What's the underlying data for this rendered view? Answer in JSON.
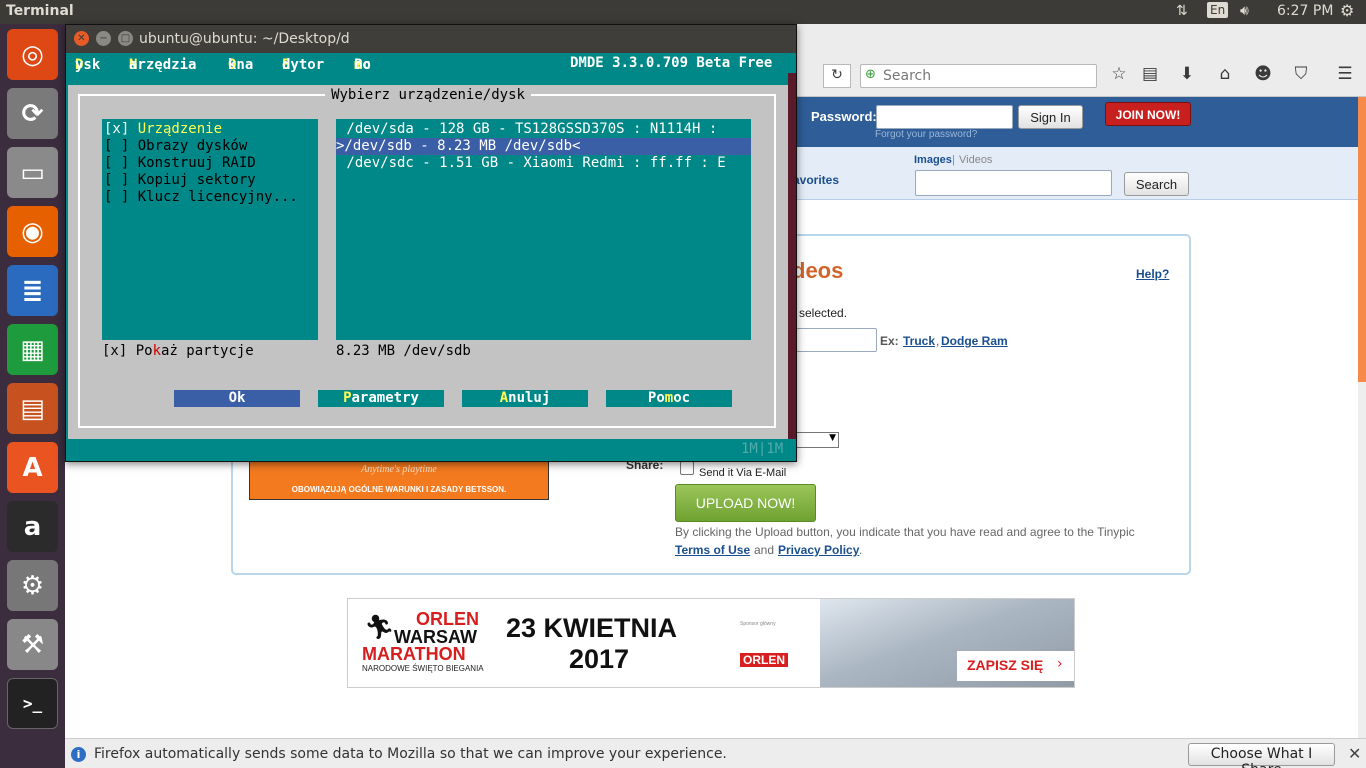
{
  "topbar": {
    "app_title": "Terminal",
    "keyboard": "En",
    "time": "6:27 PM"
  },
  "launcher": {
    "items": [
      {
        "name": "ubuntu-dash",
        "glyph": "◎",
        "color": "#dd4814"
      },
      {
        "name": "software-updater",
        "glyph": "⟳",
        "color": "#7a7a7a"
      },
      {
        "name": "file-manager",
        "glyph": "▭",
        "color": "#8a8a8a"
      },
      {
        "name": "firefox",
        "glyph": "◉",
        "color": "#e66000"
      },
      {
        "name": "libreoffice-writer",
        "glyph": "≣",
        "color": "#2a6bbf"
      },
      {
        "name": "libreoffice-calc",
        "glyph": "▦",
        "color": "#1e9b3c"
      },
      {
        "name": "libreoffice-impress",
        "glyph": "▤",
        "color": "#c7511f"
      },
      {
        "name": "ubuntu-software",
        "glyph": "A",
        "color": "#e95420"
      },
      {
        "name": "amazon",
        "glyph": "a",
        "color": "#2b2b2b"
      },
      {
        "name": "system-settings",
        "glyph": "⚙",
        "color": "#777"
      },
      {
        "name": "disks",
        "glyph": "⚒",
        "color": "#888"
      },
      {
        "name": "terminal",
        "glyph": ">_",
        "color": "#222"
      }
    ]
  },
  "firefox": {
    "search_placeholder": "Search",
    "site": {
      "password_label": "Password:",
      "forgot_link": "Forgot your password?",
      "sign_in": "Sign In",
      "join_now": "JOIN NOW!",
      "favorites": "avorites",
      "images_tab": "Images",
      "sep": "|",
      "videos_tab": "Videos",
      "search_button": "Search",
      "heading_fragment": "deos",
      "help_link": "Help?",
      "selected_text": "selected.",
      "example_label": "Ex:",
      "example_1": "Truck",
      "example_comma": ",",
      "example_2": "Dodge Ram",
      "share_label": "Share:",
      "email_option": "Send it Via E-Mail",
      "upload_button": "UPLOAD NOW!",
      "agree_text": "By clicking the Upload button, you indicate that you have read and agree to the Tinypic",
      "terms_link": "Terms of Use",
      "and_text": "and",
      "privacy_link": "Privacy Policy",
      "period": "."
    },
    "ad_betsson": {
      "tagline": "Anytime's playtime",
      "footer": "OBOWIĄZUJĄ OGÓLNE WARUNKI I ZASADY BETSSON."
    },
    "ad_orlen": {
      "brand_1": "ORLEN",
      "brand_2": "WARSAW",
      "brand_3": "MARATHON",
      "sub": "NARODOWE ŚWIĘTO BIEGANIA",
      "date_1": "23 KWIETNIA",
      "date_2": "2017",
      "sponsor_small": "Sponsor główny",
      "sponsor": "ORLEN",
      "cta": "ZAPISZ SIĘ"
    },
    "notice": {
      "text": "Firefox automatically sends some data to Mozilla so that we can improve your experience.",
      "button": "Choose What I Share"
    }
  },
  "terminal": {
    "title": "ubuntu@ubuntu: ~/Desktop/d",
    "menu": [
      {
        "pre": "",
        "hot": "D",
        "post": "ysk"
      },
      {
        "pre": "",
        "hot": "N",
        "post": "arzędzia"
      },
      {
        "pre": "",
        "hot": "O",
        "post": "kna"
      },
      {
        "pre": "",
        "hot": "E",
        "post": "dytor"
      },
      {
        "pre": "Po",
        "hot": "m",
        "post": "oc"
      }
    ],
    "version": "DMDE 3.3.0.709 Beta Free",
    "dialog_title": "Wybierz urządzenie/dysk",
    "left_options": [
      {
        "box": "[x] ",
        "label": "Urządzenie"
      },
      {
        "box": "[ ] ",
        "label": "Obrazy dysków"
      },
      {
        "box": "[ ] ",
        "label": "Konstruuj RAID"
      },
      {
        "box": "[ ] ",
        "label": "Kopiuj sektory"
      },
      {
        "box": "[ ] ",
        "label": "Klucz licencyjny..."
      }
    ],
    "devices": [
      " /dev/sda - 128 GB - TS128GSSD370S : N1114H :",
      ">/dev/sdb - 8.23 MB /dev/sdb<",
      " /dev/sdc - 1.51 GB - Xiaomi Redmi : ff.ff : E"
    ],
    "show_partitions": {
      "pre": "[x] Po",
      "hot": "k",
      "post": "aż partycje"
    },
    "selected_info": "8.23 MB /dev/sdb",
    "buttons": [
      {
        "pre": "",
        "hot": "",
        "post": "Ok"
      },
      {
        "pre": "",
        "hot": "P",
        "post": "arametry"
      },
      {
        "pre": "",
        "hot": "A",
        "post": "nuluj"
      },
      {
        "pre": "Po",
        "hot": "m",
        "post": "oc"
      }
    ],
    "status_right": "1M|1M"
  }
}
